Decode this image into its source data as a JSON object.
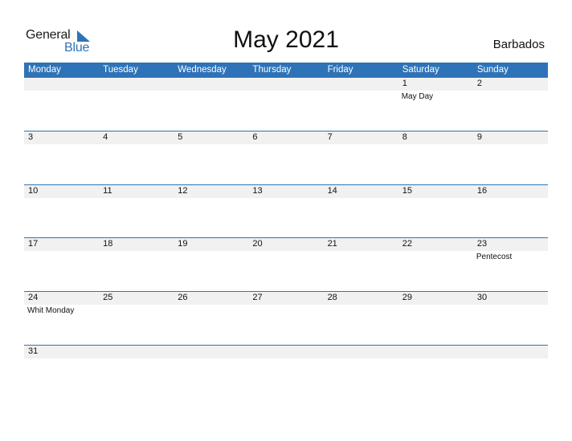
{
  "logo": {
    "word1": "General",
    "word2": "Blue"
  },
  "title": "May 2021",
  "country": "Barbados",
  "colors": {
    "accent": "#2e73b8",
    "day_band": "#f1f1f1"
  },
  "weekdays": [
    "Monday",
    "Tuesday",
    "Wednesday",
    "Thursday",
    "Friday",
    "Saturday",
    "Sunday"
  ],
  "weeks": [
    [
      {
        "day": ""
      },
      {
        "day": ""
      },
      {
        "day": ""
      },
      {
        "day": ""
      },
      {
        "day": ""
      },
      {
        "day": "1",
        "event": "May Day"
      },
      {
        "day": "2"
      }
    ],
    [
      {
        "day": "3"
      },
      {
        "day": "4"
      },
      {
        "day": "5"
      },
      {
        "day": "6"
      },
      {
        "day": "7"
      },
      {
        "day": "8"
      },
      {
        "day": "9"
      }
    ],
    [
      {
        "day": "10"
      },
      {
        "day": "11"
      },
      {
        "day": "12"
      },
      {
        "day": "13"
      },
      {
        "day": "14"
      },
      {
        "day": "15"
      },
      {
        "day": "16"
      }
    ],
    [
      {
        "day": "17"
      },
      {
        "day": "18"
      },
      {
        "day": "19"
      },
      {
        "day": "20"
      },
      {
        "day": "21"
      },
      {
        "day": "22"
      },
      {
        "day": "23",
        "event": "Pentecost"
      }
    ],
    [
      {
        "day": "24",
        "event": "Whit Monday"
      },
      {
        "day": "25"
      },
      {
        "day": "26"
      },
      {
        "day": "27"
      },
      {
        "day": "28"
      },
      {
        "day": "29"
      },
      {
        "day": "30"
      }
    ],
    [
      {
        "day": "31"
      },
      {
        "day": ""
      },
      {
        "day": ""
      },
      {
        "day": ""
      },
      {
        "day": ""
      },
      {
        "day": ""
      },
      {
        "day": ""
      }
    ]
  ]
}
